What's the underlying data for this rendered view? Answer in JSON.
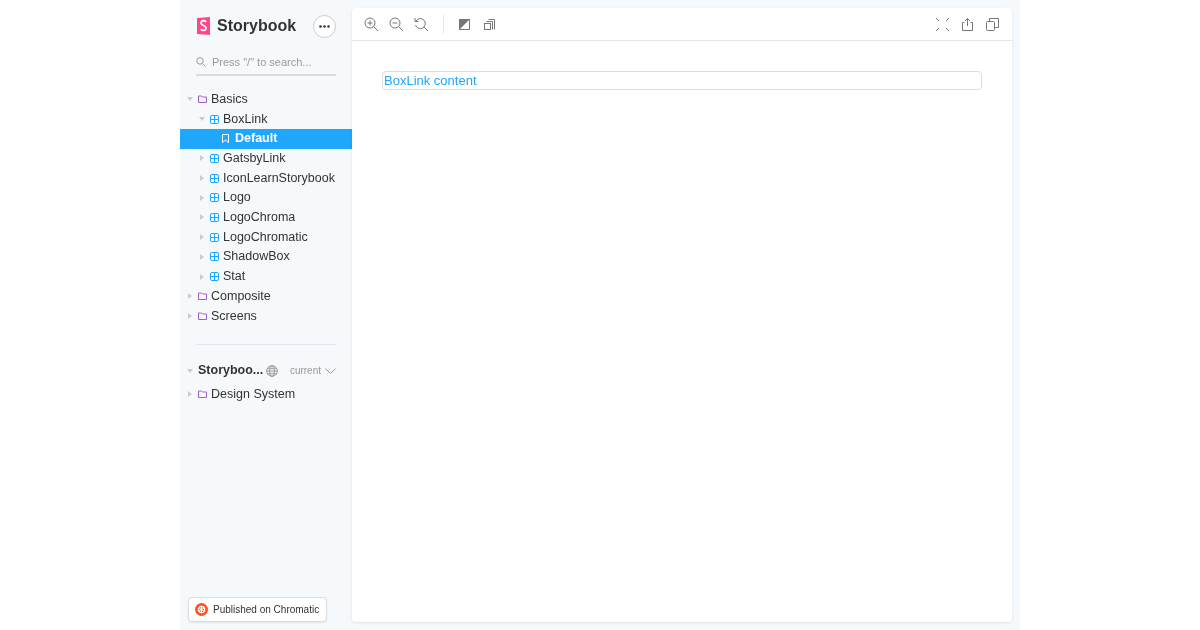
{
  "brand": {
    "name": "Storybook"
  },
  "search": {
    "placeholder": "Press \"/\" to search..."
  },
  "tree": [
    {
      "kind": "folder",
      "label": "Basics",
      "expanded": true,
      "selected": false,
      "children": [
        {
          "kind": "component",
          "label": "BoxLink",
          "expanded": true,
          "selected": false,
          "children": [
            {
              "kind": "story",
              "label": "Default",
              "selected": true
            }
          ]
        },
        {
          "kind": "component",
          "label": "GatsbyLink",
          "expanded": false,
          "selected": false
        },
        {
          "kind": "component",
          "label": "IconLearnStorybook",
          "expanded": false,
          "selected": false
        },
        {
          "kind": "component",
          "label": "Logo",
          "expanded": false,
          "selected": false
        },
        {
          "kind": "component",
          "label": "LogoChroma",
          "expanded": false,
          "selected": false
        },
        {
          "kind": "component",
          "label": "LogoChromatic",
          "expanded": false,
          "selected": false
        },
        {
          "kind": "component",
          "label": "ShadowBox",
          "expanded": false,
          "selected": false
        },
        {
          "kind": "component",
          "label": "Stat",
          "expanded": false,
          "selected": false
        }
      ]
    },
    {
      "kind": "folder",
      "label": "Composite",
      "expanded": false,
      "selected": false
    },
    {
      "kind": "folder",
      "label": "Screens",
      "expanded": false,
      "selected": false
    }
  ],
  "ref": {
    "title": "Storyboo...",
    "version": "current",
    "expanded": true,
    "tree": [
      {
        "kind": "folder",
        "label": "Design System",
        "expanded": false,
        "selected": false
      }
    ]
  },
  "preview": {
    "content": "BoxLink content"
  },
  "badge": {
    "label": "Published on Chromatic"
  }
}
